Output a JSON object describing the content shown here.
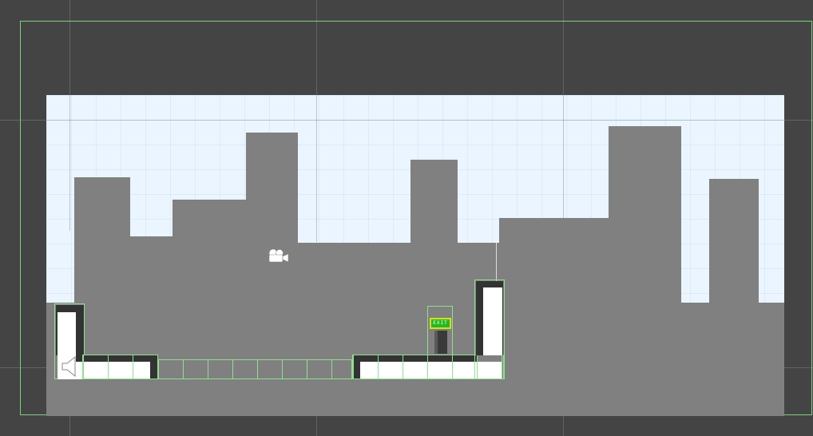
{
  "scene": {
    "background": "#444444",
    "sky_color": "#eaf5ff",
    "building_color": "#808080",
    "bounds_color": "#7ad27a",
    "tile_outline_color": "#8fe08f"
  },
  "exit_sign": {
    "label": "EXIT",
    "color": "#22bb22",
    "border": "#dddd11"
  },
  "gizmos": {
    "camera": "camera-icon",
    "audio": "speaker-icon"
  }
}
